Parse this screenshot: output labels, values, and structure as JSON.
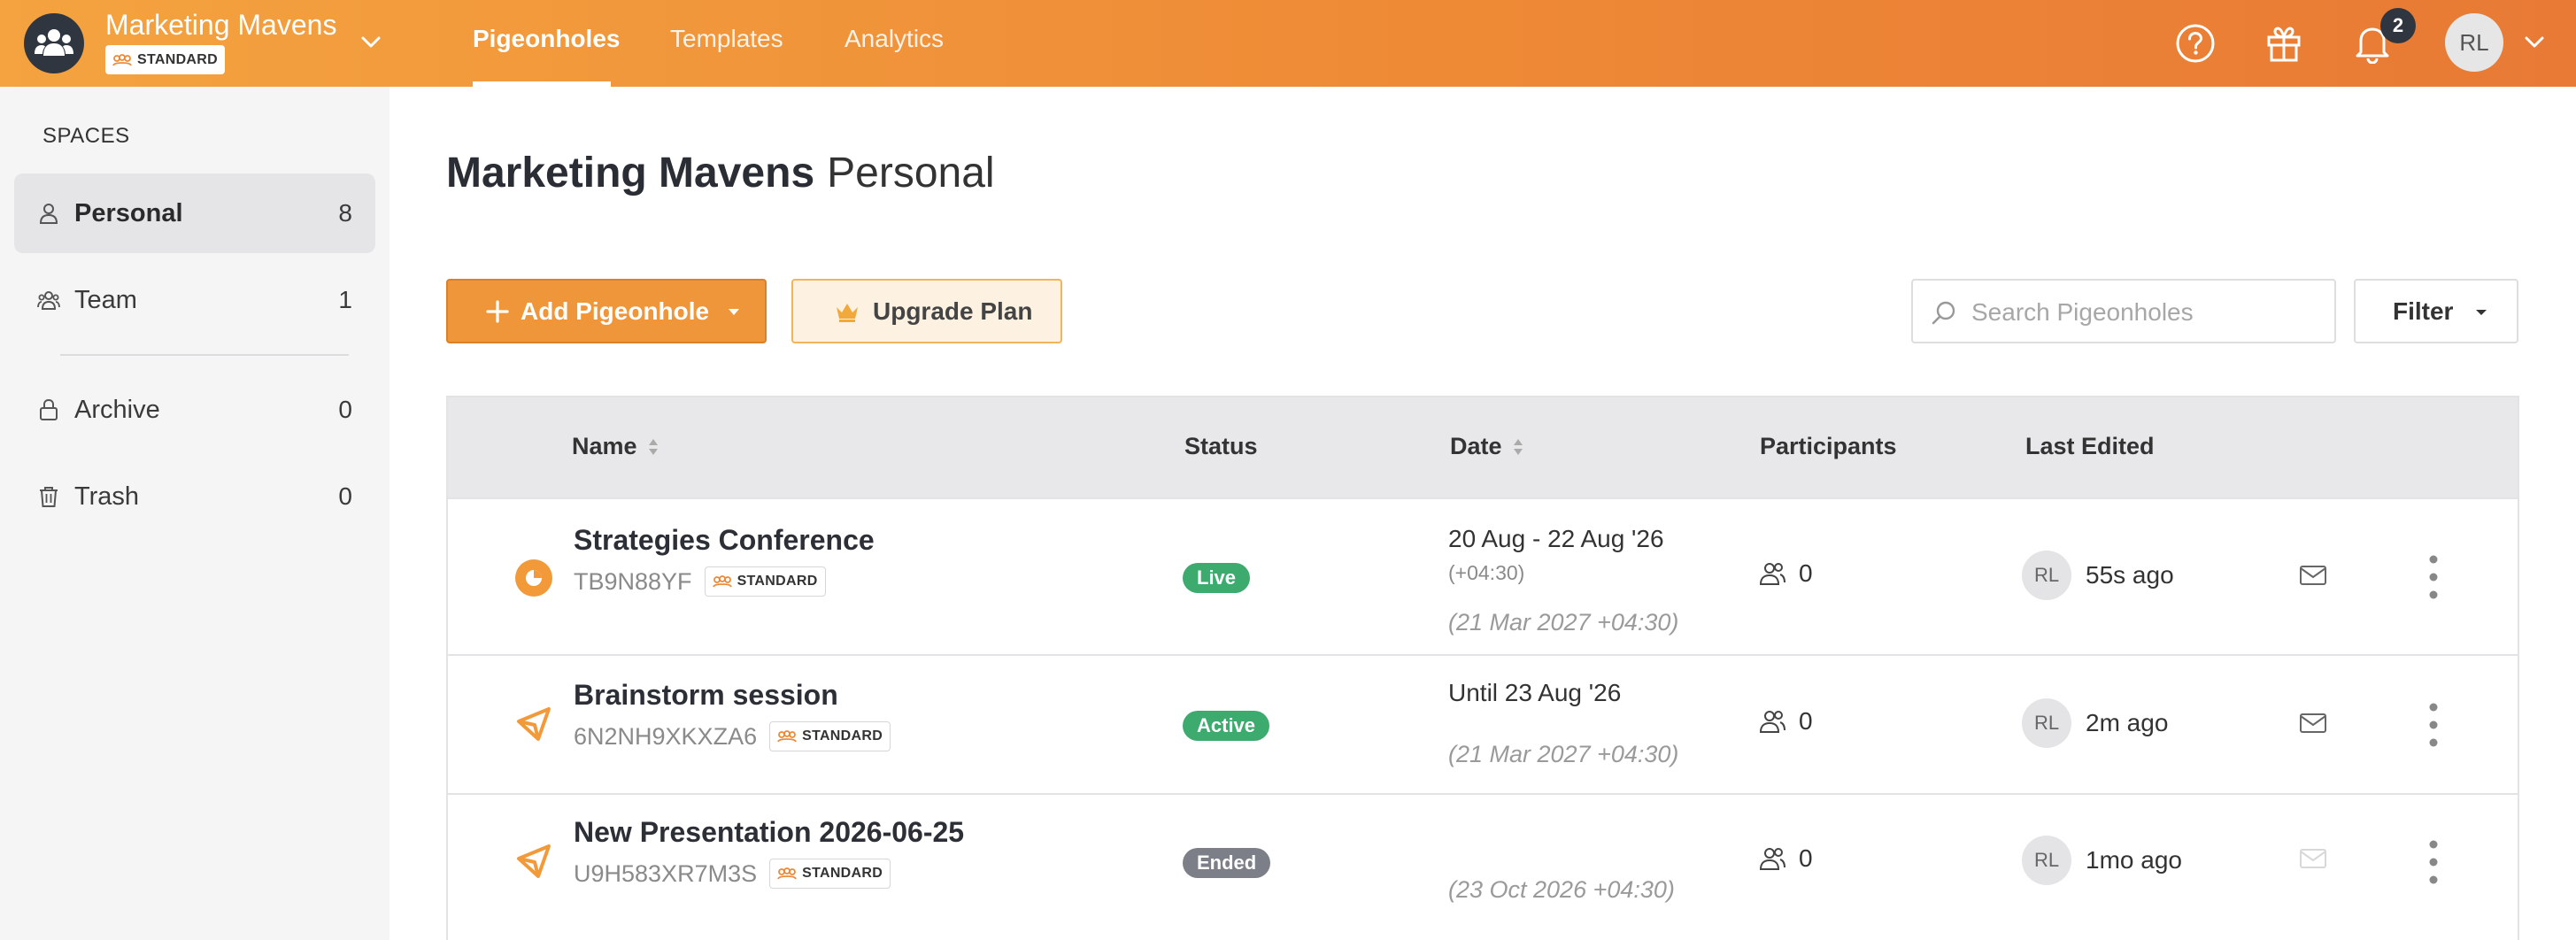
{
  "header": {
    "org_name": "Marketing Mavens",
    "org_plan": "STANDARD",
    "tabs": [
      {
        "label": "Pigeonholes",
        "active": true
      },
      {
        "label": "Templates",
        "active": false
      },
      {
        "label": "Analytics",
        "active": false
      }
    ],
    "notification_count": "2",
    "user_initials": "RL",
    "accent_color": "#ee8a36"
  },
  "sidebar": {
    "section_label": "SPACES",
    "items": [
      {
        "label": "Personal",
        "count": "8",
        "icon": "person-icon",
        "active": true
      },
      {
        "label": "Team",
        "count": "1",
        "icon": "team-icon",
        "active": false
      },
      {
        "label": "Archive",
        "count": "0",
        "icon": "archive-icon",
        "active": false
      },
      {
        "label": "Trash",
        "count": "0",
        "icon": "trash-icon",
        "active": false
      }
    ]
  },
  "main": {
    "title_org": "Marketing Mavens",
    "title_space": "Personal",
    "add_button": "Add Pigeonhole",
    "upgrade_button": "Upgrade Plan",
    "search_placeholder": "Search Pigeonholes",
    "filter_button": "Filter"
  },
  "table": {
    "columns": {
      "name": "Name",
      "status": "Status",
      "date": "Date",
      "participants": "Participants",
      "last_edited": "Last Edited"
    },
    "rows": [
      {
        "type_icon": "live-event-icon",
        "name": "Strategies Conference",
        "code": "TB9N88YF",
        "plan": "STANDARD",
        "status": "Live",
        "status_color": "#3daa6e",
        "date": "20 Aug - 22 Aug '26",
        "tz": "(+04:30)",
        "expiry": "(21 Mar 2027 +04:30)",
        "participants": "0",
        "editor_initials": "RL",
        "last_edited": "55s ago",
        "mail_enabled": true
      },
      {
        "type_icon": "session-icon",
        "name": "Brainstorm session",
        "code": "6N2NH9XKXZA6",
        "plan": "STANDARD",
        "status": "Active",
        "status_color": "#3daa6e",
        "date": "Until 23 Aug '26",
        "tz": "",
        "expiry": "(21 Mar 2027 +04:30)",
        "participants": "0",
        "editor_initials": "RL",
        "last_edited": "2m ago",
        "mail_enabled": true
      },
      {
        "type_icon": "session-icon",
        "name": "New Presentation 2026-06-25",
        "code": "U9H583XR7M3S",
        "plan": "STANDARD",
        "status": "Ended",
        "status_color": "#7c7f87",
        "date": "",
        "tz": "",
        "expiry": "(23 Oct 2026 +04:30)",
        "participants": "0",
        "editor_initials": "RL",
        "last_edited": "1mo ago",
        "mail_enabled": false
      }
    ]
  }
}
